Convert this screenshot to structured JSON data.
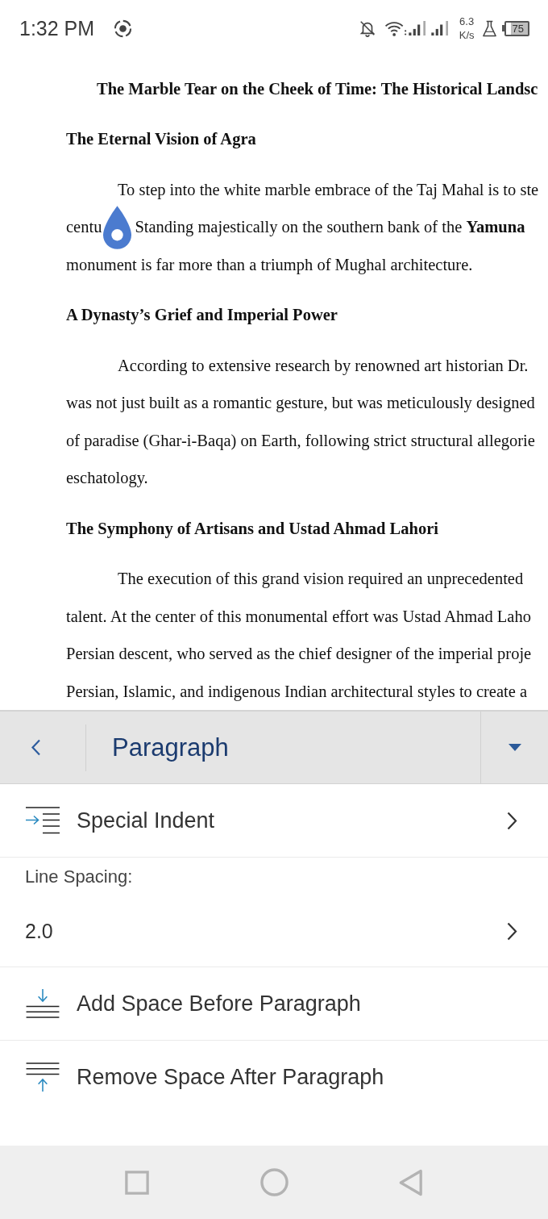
{
  "status_bar": {
    "time": "1:32 PM",
    "network_speed": {
      "value": "6.3",
      "unit": "K/s"
    },
    "battery": "75"
  },
  "document": {
    "title": "The Marble Tear on the Cheek of Time: The Historical Landsc",
    "sections": [
      {
        "heading": "The Eternal Vision of Agra",
        "lines": [
          {
            "text": "To step into the white marble embrace of the Taj Mahal is to ste"
          },
          {
            "text": "centu",
            "selection_handle": true,
            "rest": "Standing majestically on the southern bank of the **Yamuna**"
          },
          {
            "text": "monument is far more than a triumph of Mughal architecture."
          }
        ]
      },
      {
        "heading": "A Dynasty’s Grief and Imperial Power",
        "lines": [
          {
            "text": "According to extensive research by renowned art historian Dr."
          },
          {
            "text": "was not just built as a romantic gesture, but was meticulously designed"
          },
          {
            "text": "of paradise (Ghar-i-Baqa) on Earth, following strict structural allegorie"
          },
          {
            "text": "eschatology."
          }
        ]
      },
      {
        "heading": "The Symphony of Artisans and Ustad Ahmad Lahori",
        "lines": [
          {
            "text": "The execution of this grand vision required an unprecedented"
          },
          {
            "text": "talent. At the center of this monumental effort was Ustad Ahmad Laho"
          },
          {
            "text": "Persian descent, who served as the chief designer of the imperial proje"
          },
          {
            "text": "Persian, Islamic, and indigenous Indian architectural styles to create a"
          }
        ]
      }
    ]
  },
  "panel": {
    "title": "Paragraph",
    "items": [
      {
        "kind": "indent",
        "label": "Special Indent"
      },
      {
        "kind": "caption",
        "label": "Line Spacing:"
      },
      {
        "kind": "value",
        "value": "2.0"
      },
      {
        "kind": "space-before",
        "label": "Add Space Before Paragraph"
      },
      {
        "kind": "space-after",
        "label": "Remove Space After Paragraph"
      }
    ]
  }
}
